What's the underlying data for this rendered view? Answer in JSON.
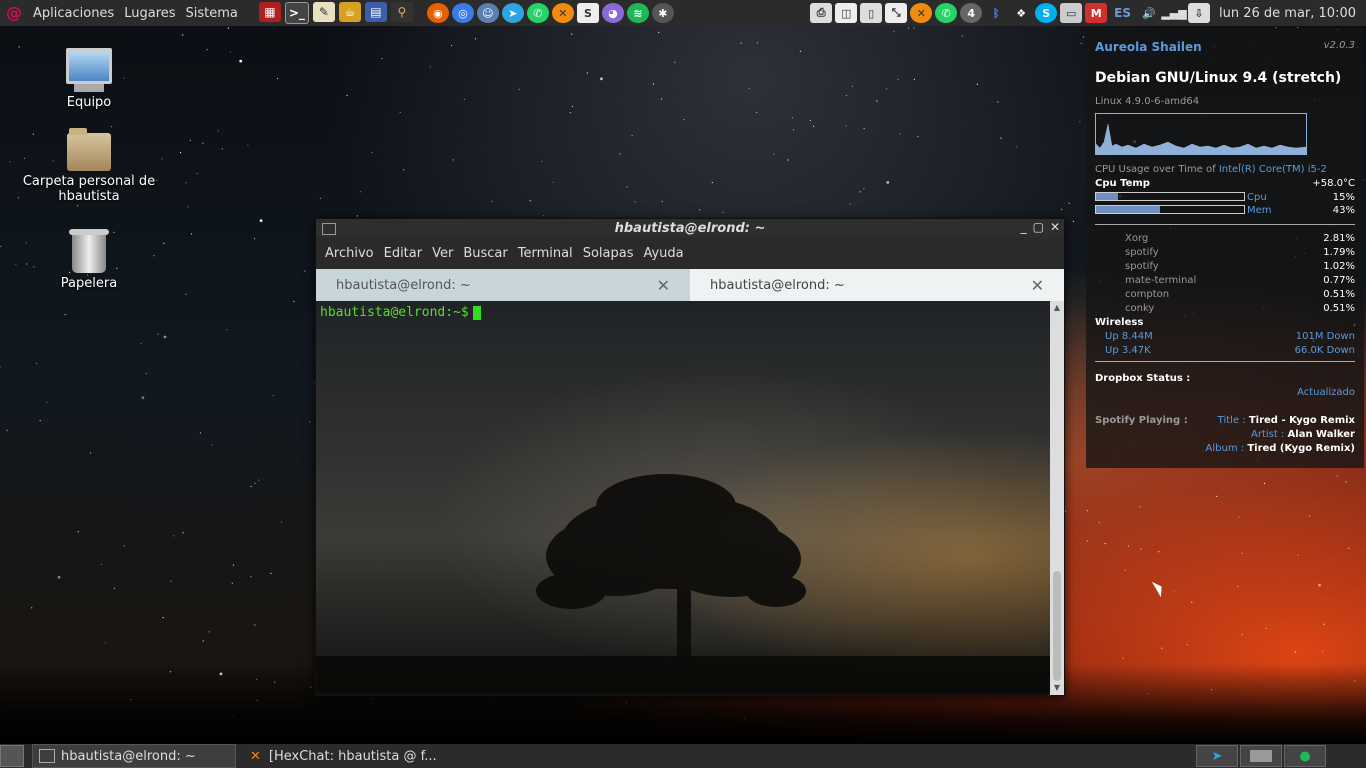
{
  "top_panel": {
    "menus": [
      "Aplicaciones",
      "Lugares",
      "Sistema"
    ],
    "language": "ES",
    "clock": "lun 26 de mar, 10:00",
    "notification_count": "4"
  },
  "desktop_icons": {
    "computer": "Equipo",
    "home_folder": "Carpeta personal de hbautista",
    "trash": "Papelera"
  },
  "terminal": {
    "window_title": "hbautista@elrond: ~",
    "menu": [
      "Archivo",
      "Editar",
      "Ver",
      "Buscar",
      "Terminal",
      "Solapas",
      "Ayuda"
    ],
    "tabs": [
      {
        "label": "hbautista@elrond: ~",
        "active": false
      },
      {
        "label": "hbautista@elrond: ~",
        "active": true
      }
    ],
    "prompt": "hbautista@elrond:~$"
  },
  "conky": {
    "user": "Aureola Shailen",
    "version": "v2.0.3",
    "os": "Debian GNU/Linux 9.4 (stretch)",
    "kernel": "Linux 4.9.0-6-amd64",
    "cpu_usage_label": "CPU Usage over Time of",
    "cpu_model": "Intel(R) Core(TM) i5-2",
    "cpu_temp_label": "Cpu Temp",
    "cpu_temp": "+58.0°C",
    "cpu_label": "Cpu",
    "cpu_pct": "15%",
    "cpu_fill": 0.15,
    "mem_label": "Mem",
    "mem_pct": "43%",
    "mem_fill": 0.43,
    "processes": [
      {
        "name": "Xorg",
        "pct": "2.81%"
      },
      {
        "name": "spotify",
        "pct": "1.79%"
      },
      {
        "name": "spotify",
        "pct": "1.02%"
      },
      {
        "name": "mate-terminal",
        "pct": "0.77%"
      },
      {
        "name": "compton",
        "pct": "0.51%"
      },
      {
        "name": "conky",
        "pct": "0.51%"
      }
    ],
    "wireless_label": "Wireless",
    "up_total": "Up 8.44M",
    "down_total": "101M Down",
    "up_rate": "Up 3.47K",
    "down_rate": "66.0K Down",
    "dropbox_label": "Dropbox Status :",
    "dropbox_status": "Actualizado",
    "spotify_label": "Spotify Playing :",
    "title_label": "Title :",
    "title": "Tired - Kygo Remix",
    "artist_label": "Artist :",
    "artist": "Alan Walker",
    "album_label": "Album :",
    "album": "Tired (Kygo Remix)"
  },
  "taskbar": {
    "tasks": [
      {
        "label": "hbautista@elrond: ~",
        "active": true
      },
      {
        "label": "[HexChat: hbautista @ f...",
        "active": false
      }
    ]
  }
}
